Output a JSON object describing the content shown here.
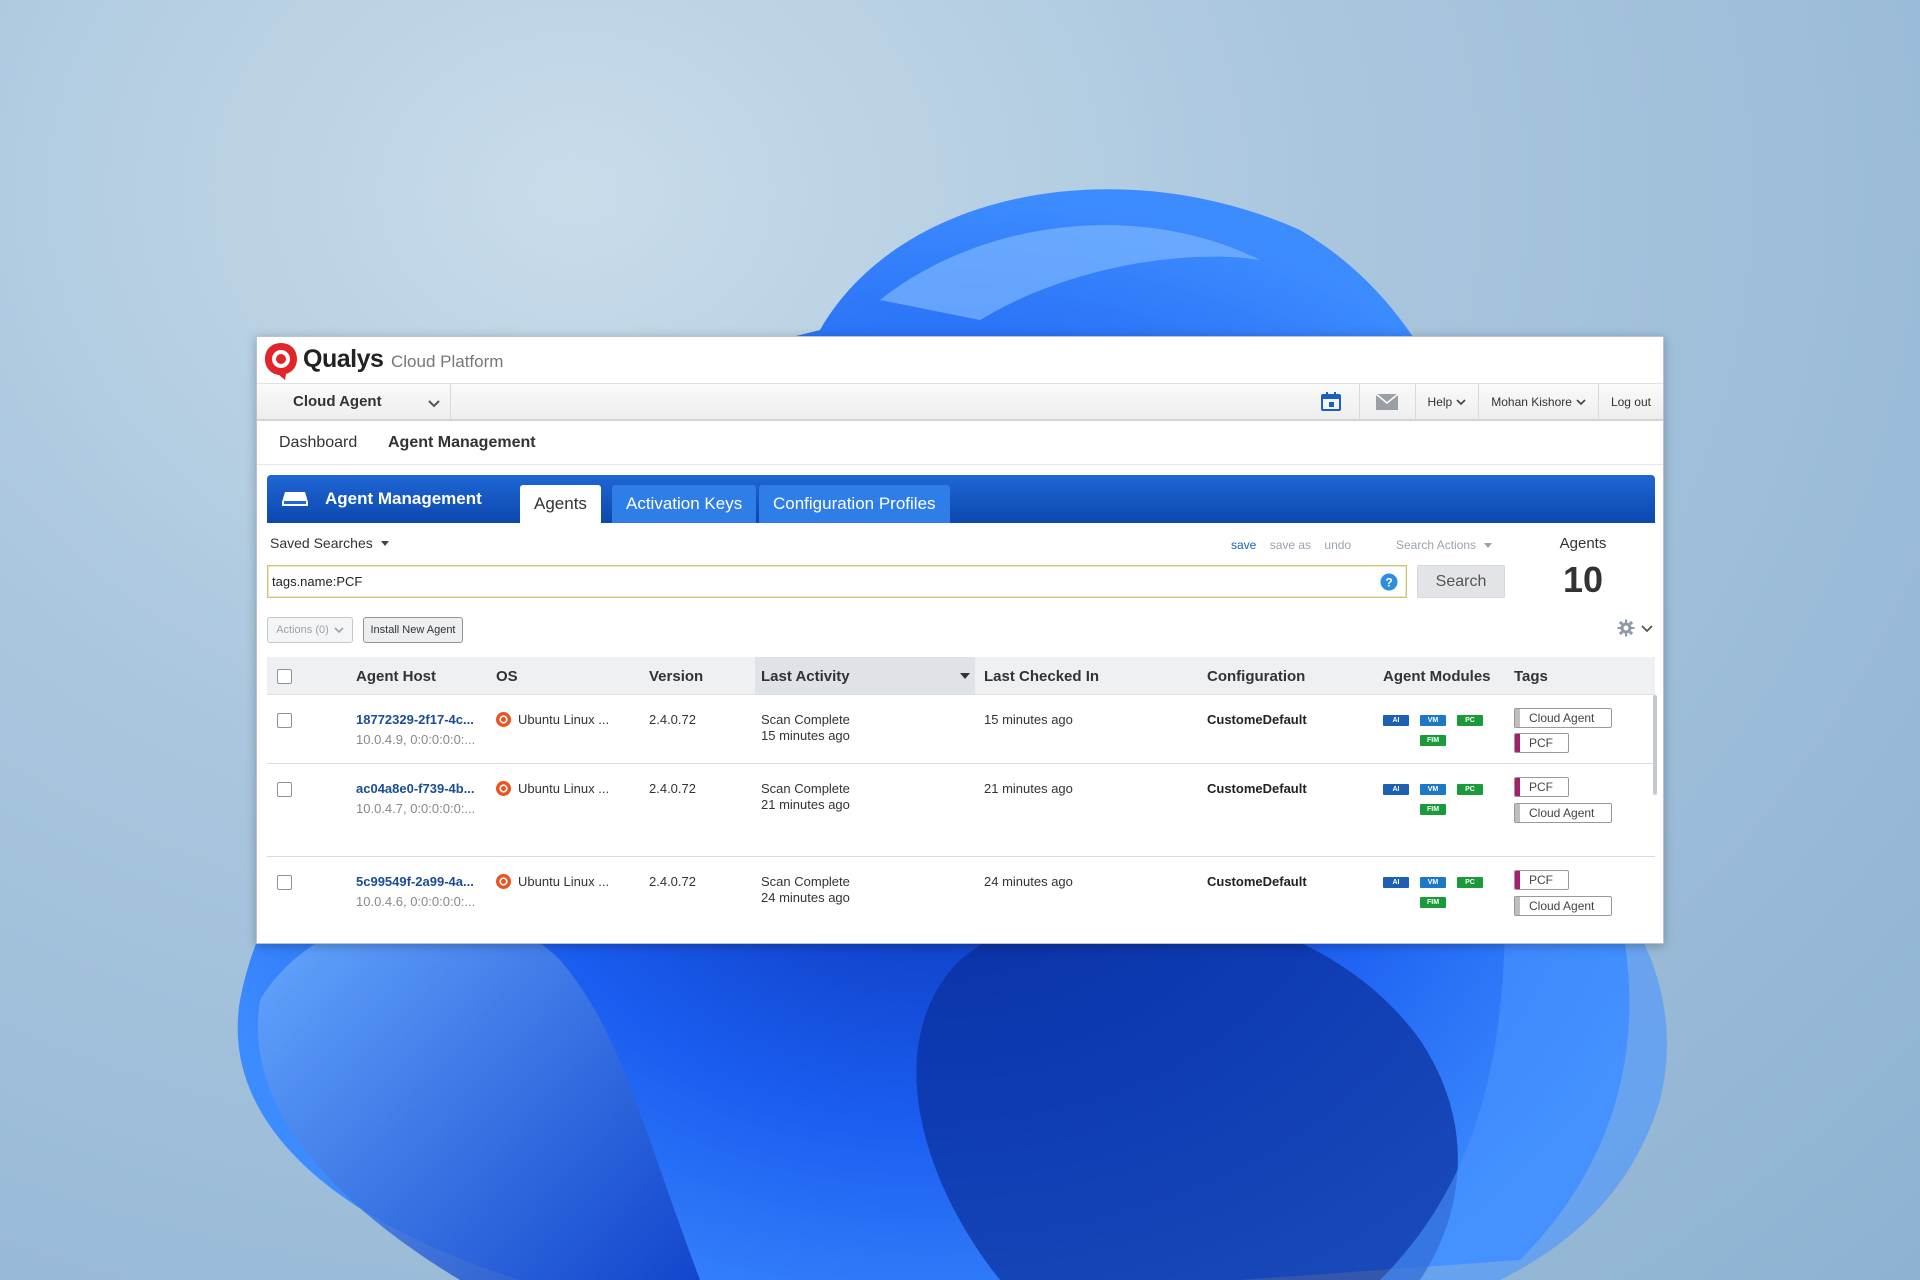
{
  "brand": {
    "name": "Qualys",
    "suffix": "Cloud Platform"
  },
  "app_bar": {
    "app_name": "Cloud Agent",
    "help": "Help",
    "user": "Mohan Kishore",
    "logout": "Log out"
  },
  "subnav": {
    "items": [
      "Dashboard",
      "Agent Management"
    ],
    "active": 1
  },
  "module": {
    "title": "Agent Management",
    "tabs": [
      "Agents",
      "Activation Keys",
      "Configuration Profiles"
    ],
    "active_tab": 0
  },
  "search": {
    "saved_searches": "Saved Searches",
    "save": "save",
    "save_as": "save as",
    "undo": "undo",
    "search_actions": "Search Actions",
    "query": "tags.name:PCF",
    "button": "Search"
  },
  "agents_summary": {
    "label": "Agents",
    "count": "10"
  },
  "toolbar": {
    "actions": "Actions (0)",
    "install": "Install New Agent"
  },
  "table": {
    "columns": [
      "Agent Host",
      "OS",
      "Version",
      "Last Activity",
      "Last Checked In",
      "Configuration",
      "Agent Modules",
      "Tags"
    ],
    "sorted_column": "Last Activity",
    "rows": [
      {
        "host": "18772329-2f17-4c...",
        "host_sub": "10.0.4.9, 0:0:0:0:0:...",
        "os": "Ubuntu Linux ...",
        "version": "2.4.0.72",
        "activity_1": "Scan Complete",
        "activity_2": "15 minutes ago",
        "checked_in": "15 minutes ago",
        "config": "CustomeDefault",
        "modules": [
          "AI",
          "VM",
          "PC",
          "FIM"
        ],
        "tags": [
          "Cloud Agent",
          "PCF"
        ]
      },
      {
        "host": "ac04a8e0-f739-4b...",
        "host_sub": "10.0.4.7, 0:0:0:0:0:...",
        "os": "Ubuntu Linux ...",
        "version": "2.4.0.72",
        "activity_1": "Scan Complete",
        "activity_2": "21 minutes ago",
        "checked_in": "21 minutes ago",
        "config": "CustomeDefault",
        "modules": [
          "AI",
          "VM",
          "PC",
          "FIM"
        ],
        "tags": [
          "PCF",
          "Cloud Agent"
        ]
      },
      {
        "host": "5c99549f-2a99-4a...",
        "host_sub": "10.0.4.6, 0:0:0:0:0:...",
        "os": "Ubuntu Linux ...",
        "version": "2.4.0.72",
        "activity_1": "Scan Complete",
        "activity_2": "24 minutes ago",
        "checked_in": "24 minutes ago",
        "config": "CustomeDefault",
        "modules": [
          "AI",
          "VM",
          "PC",
          "FIM"
        ],
        "tags": [
          "PCF",
          "Cloud Agent"
        ]
      }
    ]
  },
  "colors": {
    "brand_red": "#e0262a",
    "module_blue": "#1f66d6",
    "tag_pcf": "#a3206a",
    "ubuntu_orange": "#e95420"
  },
  "icons": [
    "qualys-logo",
    "chevron-down-icon",
    "calendar-icon",
    "mail-icon",
    "module-icon",
    "help-icon",
    "gear-icon",
    "ubuntu-icon"
  ]
}
